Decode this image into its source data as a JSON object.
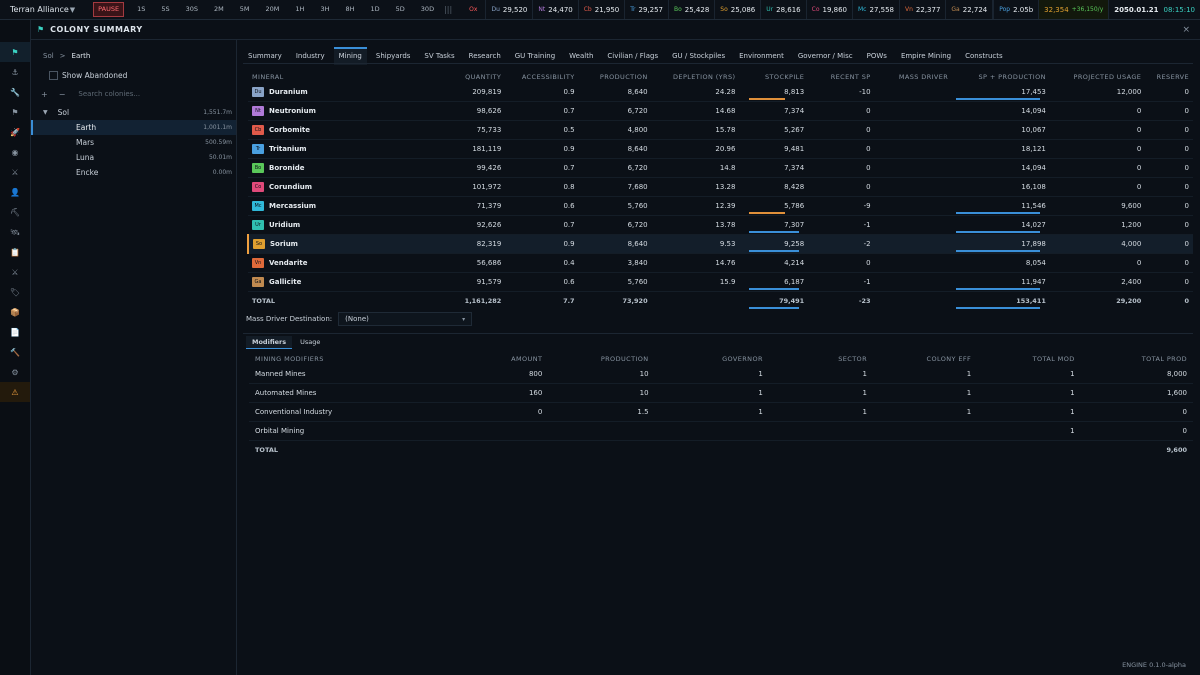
{
  "topbar": {
    "empire": "Terran Alliance",
    "speeds": [
      "PAUSE",
      "1S",
      "5S",
      "30S",
      "2M",
      "5M",
      "20M",
      "1H",
      "3H",
      "8H",
      "1D",
      "5D",
      "30D"
    ],
    "pause_glyph": "|||",
    "resources": [
      {
        "key": "Ox",
        "value": "",
        "color": "#ff5a5a"
      },
      {
        "key": "Du",
        "value": "29,520",
        "color": "#8aa4c8"
      },
      {
        "key": "Nt",
        "value": "24,470",
        "color": "#b07ad8"
      },
      {
        "key": "Cb",
        "value": "21,950",
        "color": "#e05a4a"
      },
      {
        "key": "Tr",
        "value": "29,257",
        "color": "#4aa0e0"
      },
      {
        "key": "Bo",
        "value": "25,428",
        "color": "#5ac85a"
      },
      {
        "key": "So",
        "value": "25,086",
        "color": "#e0a030"
      },
      {
        "key": "Ur",
        "value": "28,616",
        "color": "#30c0b0"
      },
      {
        "key": "Co",
        "value": "19,860",
        "color": "#e04a7a"
      },
      {
        "key": "Mc",
        "value": "27,558",
        "color": "#30b8d8"
      },
      {
        "key": "Vn",
        "value": "22,377",
        "color": "#e06a3a"
      },
      {
        "key": "Ga",
        "value": "22,724",
        "color": "#c08a50"
      }
    ],
    "pop_label": "Pop",
    "pop_value": "2.05b",
    "wealth": "32,354",
    "wealth_rate": "+36,150/y",
    "date": "2050.01.21",
    "time": "08:15:10"
  },
  "sidebar": {
    "icons": [
      "flag-icon",
      "anchor-icon",
      "wrench-icon",
      "flag-small-icon",
      "rocket-icon",
      "target-icon",
      "crossed-swords-icon",
      "person-icon",
      "pickaxe-icon",
      "satellite-icon",
      "clipboard-icon",
      "crossed-swords-icon-2",
      "tag-icon",
      "box-icon",
      "document-icon",
      "tools-icon",
      "gear-icon",
      "warning-icon"
    ],
    "glyphs": [
      "⚑",
      "⚓",
      "🔧",
      "⚑",
      "🚀",
      "◉",
      "⚔",
      "👤",
      "⛏",
      "🛰",
      "📋",
      "⚔",
      "🏷",
      "📦",
      "📄",
      "🔨",
      "⚙",
      "⚠"
    ]
  },
  "window": {
    "title": "COLONY SUMMARY",
    "close": "×"
  },
  "left": {
    "crumb_system": "Sol",
    "crumb_sep": ">",
    "crumb_colony": "Earth",
    "show_abandoned": "Show Abandoned",
    "add": "+",
    "remove": "−",
    "search_placeholder": "Search colonies...",
    "system": {
      "name": "Sol",
      "value": "1,551.7m"
    },
    "colonies": [
      {
        "name": "Earth",
        "value": "1,001.1m"
      },
      {
        "name": "Mars",
        "value": "500.59m"
      },
      {
        "name": "Luna",
        "value": "50.01m"
      },
      {
        "name": "Encke",
        "value": "0.00m"
      }
    ]
  },
  "tabs": [
    "Summary",
    "Industry",
    "Mining",
    "Shipyards",
    "SV Tasks",
    "Research",
    "GU Training",
    "Wealth",
    "Civilian / Flags",
    "GU / Stockpiles",
    "Environment",
    "Governor / Misc",
    "POWs",
    "Empire Mining",
    "Constructs"
  ],
  "mining": {
    "headers": [
      "MINERAL",
      "QUANTITY",
      "ACCESSIBILITY",
      "PRODUCTION",
      "DEPLETION (YRS)",
      "STOCKPILE",
      "RECENT SP",
      "MASS DRIVER",
      "SP + PRODUCTION",
      "PROJECTED USAGE",
      "RESERVE"
    ],
    "rows": [
      {
        "code": "Du",
        "color": "#8aa4c8",
        "name": "Duranium",
        "quantity": "209,819",
        "access": "0.9",
        "production": "8,640",
        "depletion": "24.28",
        "stockpile": "8,813",
        "recent": "-10",
        "mass": "",
        "sp": "17,453",
        "usage": "12,000",
        "reserve": "0"
      },
      {
        "code": "Nt",
        "color": "#b07ad8",
        "name": "Neutronium",
        "quantity": "98,626",
        "access": "0.7",
        "production": "6,720",
        "depletion": "14.68",
        "stockpile": "7,374",
        "recent": "0",
        "mass": "",
        "sp": "14,094",
        "usage": "0",
        "reserve": "0"
      },
      {
        "code": "Cb",
        "color": "#e05a4a",
        "name": "Corbomite",
        "quantity": "75,733",
        "access": "0.5",
        "production": "4,800",
        "depletion": "15.78",
        "stockpile": "5,267",
        "recent": "0",
        "mass": "",
        "sp": "10,067",
        "usage": "0",
        "reserve": "0"
      },
      {
        "code": "Tr",
        "color": "#4aa0e0",
        "name": "Tritanium",
        "quantity": "181,119",
        "access": "0.9",
        "production": "8,640",
        "depletion": "20.96",
        "stockpile": "9,481",
        "recent": "0",
        "mass": "",
        "sp": "18,121",
        "usage": "0",
        "reserve": "0"
      },
      {
        "code": "Bo",
        "color": "#5ac85a",
        "name": "Boronide",
        "quantity": "99,426",
        "access": "0.7",
        "production": "6,720",
        "depletion": "14.8",
        "stockpile": "7,374",
        "recent": "0",
        "mass": "",
        "sp": "14,094",
        "usage": "0",
        "reserve": "0"
      },
      {
        "code": "Co",
        "color": "#e04a7a",
        "name": "Corundium",
        "quantity": "101,972",
        "access": "0.8",
        "production": "7,680",
        "depletion": "13.28",
        "stockpile": "8,428",
        "recent": "0",
        "mass": "",
        "sp": "16,108",
        "usage": "0",
        "reserve": "0"
      },
      {
        "code": "Mc",
        "color": "#30b8d8",
        "name": "Mercassium",
        "quantity": "71,379",
        "access": "0.6",
        "production": "5,760",
        "depletion": "12.39",
        "stockpile": "5,786",
        "recent": "-9",
        "mass": "",
        "sp": "11,546",
        "usage": "9,600",
        "reserve": "0"
      },
      {
        "code": "Ur",
        "color": "#30c0b0",
        "name": "Uridium",
        "quantity": "92,626",
        "access": "0.7",
        "production": "6,720",
        "depletion": "13.78",
        "stockpile": "7,307",
        "recent": "-1",
        "mass": "",
        "sp": "14,027",
        "usage": "1,200",
        "reserve": "0"
      },
      {
        "code": "So",
        "color": "#e0a030",
        "name": "Sorium",
        "quantity": "82,319",
        "access": "0.9",
        "production": "8,640",
        "depletion": "9.53",
        "stockpile": "9,258",
        "recent": "-2",
        "mass": "",
        "sp": "17,898",
        "usage": "4,000",
        "reserve": "0"
      },
      {
        "code": "Vn",
        "color": "#e06a3a",
        "name": "Vendarite",
        "quantity": "56,686",
        "access": "0.4",
        "production": "3,840",
        "depletion": "14.76",
        "stockpile": "4,214",
        "recent": "0",
        "mass": "",
        "sp": "8,054",
        "usage": "0",
        "reserve": "0"
      },
      {
        "code": "Ga",
        "color": "#c08a50",
        "name": "Gallicite",
        "quantity": "91,579",
        "access": "0.6",
        "production": "5,760",
        "depletion": "15.9",
        "stockpile": "6,187",
        "recent": "-1",
        "mass": "",
        "sp": "11,947",
        "usage": "2,400",
        "reserve": "0"
      }
    ],
    "total": {
      "label": "TOTAL",
      "quantity": "1,161,282",
      "access": "7.7",
      "production": "73,920",
      "depletion": "",
      "stockpile": "79,491",
      "recent": "-23",
      "mass": "",
      "sp": "153,411",
      "usage": "29,200",
      "reserve": "0"
    }
  },
  "mass_driver": {
    "label": "Mass Driver Destination:",
    "value": "(None)",
    "chevron": "▾"
  },
  "subtabs": [
    "Modifiers",
    "Usage"
  ],
  "modifiers": {
    "headers": [
      "MINING MODIFIERS",
      "AMOUNT",
      "PRODUCTION",
      "GOVERNOR",
      "SECTOR",
      "COLONY EFF",
      "TOTAL MOD",
      "TOTAL PROD"
    ],
    "rows": [
      [
        "Manned Mines",
        "800",
        "10",
        "1",
        "1",
        "1",
        "1",
        "8,000"
      ],
      [
        "Automated Mines",
        "160",
        "10",
        "1",
        "1",
        "1",
        "1",
        "1,600"
      ],
      [
        "Conventional Industry",
        "0",
        "1.5",
        "1",
        "1",
        "1",
        "1",
        "0"
      ],
      [
        "Orbital Mining",
        "",
        "",
        "",
        "",
        "",
        "1",
        "0"
      ]
    ],
    "total": [
      "TOTAL",
      "",
      "",
      "",
      "",
      "",
      "",
      "9,600"
    ]
  },
  "version": "ENGINE  0.1.0-alpha"
}
